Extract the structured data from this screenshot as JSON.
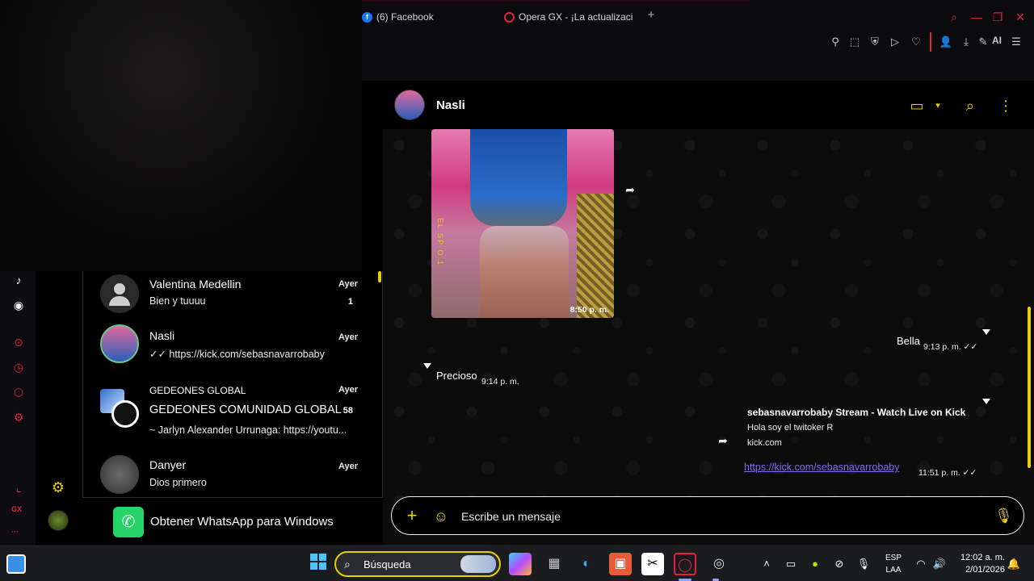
{
  "browser": {
    "tabs": [
      {
        "label": "(6) Facebook",
        "favicon": "facebook-icon"
      },
      {
        "label": "Opera GX - ¡La actualizaci",
        "favicon": "opera-icon"
      }
    ],
    "new_tab": "+",
    "ai_label": "AI"
  },
  "sidebar_text": {
    "gx": "GX",
    "more": "···"
  },
  "chats": [
    {
      "name": "Valentina Medellin",
      "preview": "Bien y tuuuu",
      "time": "Ayer",
      "unread": "1"
    },
    {
      "name": "Nasli",
      "preview": "✓✓ https://kick.com/sebasnavarrobaby",
      "time": "Ayer"
    },
    {
      "group_label": "GEDEONES GLOBAL",
      "name": "GEDEONES COMUNIDAD GLOBAL",
      "preview": "~ Jarlyn Alexander Urrunaga: https://youtu...",
      "time": "Ayer",
      "unread": "58"
    },
    {
      "name": "Danyer",
      "preview": "Dios primero",
      "time": "Ayer"
    }
  ],
  "get_whatsapp": "Obtener WhatsApp para Windows",
  "conversation": {
    "contact_name": "Nasli",
    "photo_time": "8:50 p. m.",
    "photo_overlay_text": "EL SP O 1",
    "messages": [
      {
        "text": "Bella",
        "time": "9:13 p. m. ✓✓",
        "direction": "out"
      },
      {
        "text": "Precioso",
        "time": "9:14 p. m.",
        "direction": "in"
      }
    ],
    "link_preview": {
      "title": "sebasnavarrobaby Stream - Watch Live on Kick",
      "description": "Hola soy el twitoker R",
      "domain": "kick.com",
      "url": "https://kick.com/sebasnavarrobaby",
      "time": "11:51 p. m. ✓✓"
    },
    "composer_placeholder": "Escribe un mensaje"
  },
  "taskbar": {
    "search_label": "Búsqueda",
    "language": "ESP",
    "layout": "LAA",
    "time": "12:02 a. m.",
    "date": "2/01/2026"
  },
  "colors": {
    "accent_yellow": "#e8d000",
    "opera_red": "#e0223d",
    "link_purple": "#7c6cf0",
    "whatsapp_green": "#25d366"
  }
}
